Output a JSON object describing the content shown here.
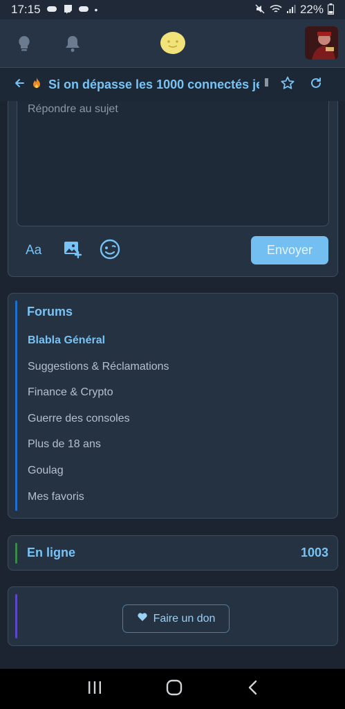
{
  "status_bar": {
    "time": "17:15",
    "battery": "22%"
  },
  "topic": {
    "title": "Si on dépasse les 1000 connectés je"
  },
  "reply": {
    "placeholder": "Répondre au sujet",
    "format_label": "Aa",
    "send_label": "Envoyer"
  },
  "forums": {
    "title": "Forums",
    "items": [
      {
        "label": "Blabla Général",
        "active": true
      },
      {
        "label": "Suggestions & Réclamations",
        "active": false
      },
      {
        "label": "Finance & Crypto",
        "active": false
      },
      {
        "label": "Guerre des consoles",
        "active": false
      },
      {
        "label": "Plus de 18 ans",
        "active": false
      },
      {
        "label": "Goulag",
        "active": false
      },
      {
        "label": "Mes favoris",
        "active": false
      }
    ]
  },
  "online": {
    "title": "En ligne",
    "count": "1003"
  },
  "donate": {
    "label": "Faire un don"
  },
  "colors": {
    "accent": "#78c3f5",
    "forums_bar": "#1f6fd0",
    "online_bar": "#3b8a4a",
    "donate_bar": "#5a48c8"
  }
}
